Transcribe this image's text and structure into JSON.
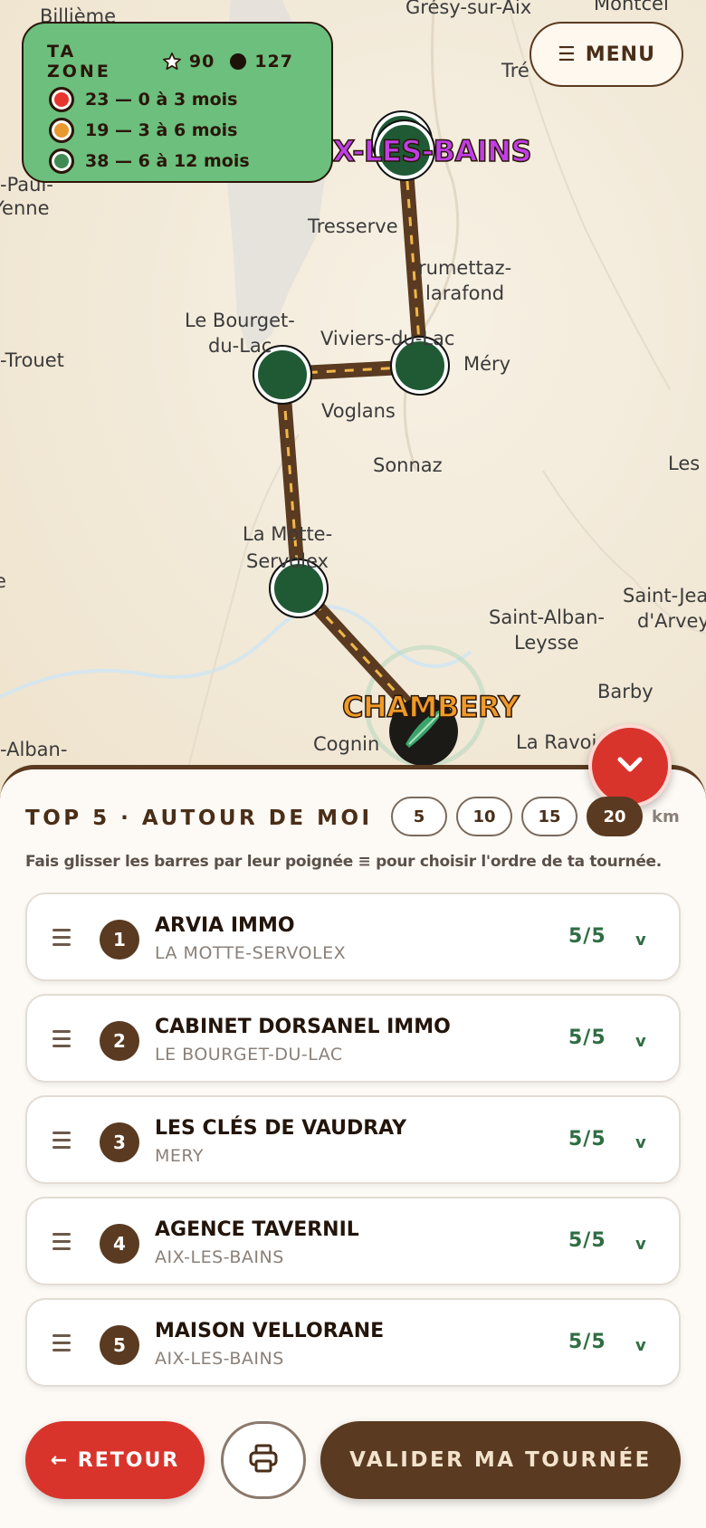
{
  "map": {
    "places": [
      {
        "id": "billieme",
        "label": "Billième"
      },
      {
        "id": "gresy",
        "label": "Grésy-sur-Aix"
      },
      {
        "id": "montcel",
        "label": "Montcel"
      },
      {
        "id": "tre",
        "label": "Tré"
      },
      {
        "id": "paul",
        "label": "-Paul-"
      },
      {
        "id": "enne",
        "label": "Yenne"
      },
      {
        "id": "tresserve",
        "label": "Tresserve"
      },
      {
        "id": "drumettaz1",
        "label": "rumettaz-"
      },
      {
        "id": "drumettaz2",
        "label": "larafond"
      },
      {
        "id": "bourget1",
        "label": "Le Bourget-"
      },
      {
        "id": "bourget2",
        "label": "du-Lac"
      },
      {
        "id": "viviers",
        "label": "Viviers-du-Lac"
      },
      {
        "id": "mery",
        "label": "Méry"
      },
      {
        "id": "trouet",
        "label": "-Trouet"
      },
      {
        "id": "voglans",
        "label": "Voglans"
      },
      {
        "id": "sonnaz",
        "label": "Sonnaz"
      },
      {
        "id": "les",
        "label": "Les"
      },
      {
        "id": "motte1",
        "label": "La Motte-"
      },
      {
        "id": "motte2",
        "label": "Servolex"
      },
      {
        "id": "saintjean1",
        "label": "Saint-Jean"
      },
      {
        "id": "saintjean2",
        "label": "d'Arvey"
      },
      {
        "id": "stalban1",
        "label": "Saint-Alban-"
      },
      {
        "id": "stalban2",
        "label": "Leysse"
      },
      {
        "id": "barby",
        "label": "Barby"
      },
      {
        "id": "cognin",
        "label": "Cognin"
      },
      {
        "id": "ravoire",
        "label": "La Ravoire"
      },
      {
        "id": "alban",
        "label": "-Alban-"
      },
      {
        "id": "e",
        "label": "e"
      }
    ],
    "city_aix": "AIX-LES-BAINS",
    "city_chambery": "CHAMBERY"
  },
  "zone": {
    "title": "TA ZONE",
    "stars": "90",
    "dots": "127",
    "legend": [
      {
        "color": "#e8342c",
        "label": "23 — 0 à 3 mois"
      },
      {
        "color": "#e89a30",
        "label": "19 — 3 à 6 mois"
      },
      {
        "color": "#3f8a55",
        "label": "38 — 6 à 12 mois"
      }
    ]
  },
  "menu": {
    "label": "MENU"
  },
  "sheet": {
    "title": "TOP 5 · AUTOUR DE MOI",
    "km_options": [
      "5",
      "10",
      "15",
      "20"
    ],
    "km_selected": "20",
    "km_unit": "km",
    "hint": "Fais glisser les barres par leur poignée ≡ pour choisir l'ordre de ta tournée.",
    "items": [
      {
        "rank": "1",
        "name": "ARVIA IMMO",
        "town": "LA MOTTE-SERVOLEX",
        "score": "5/5",
        "chevron": "v"
      },
      {
        "rank": "2",
        "name": "CABINET DORSANEL IMMO",
        "town": "LE BOURGET-DU-LAC",
        "score": "5/5",
        "chevron": "v"
      },
      {
        "rank": "3",
        "name": "LES CLÉS DE VAUDRAY",
        "town": "MERY",
        "score": "5/5",
        "chevron": "v"
      },
      {
        "rank": "4",
        "name": "AGENCE TAVERNIL",
        "town": "AIX-LES-BAINS",
        "score": "5/5",
        "chevron": "v"
      },
      {
        "rank": "5",
        "name": "MAISON VELLORANE",
        "town": "AIX-LES-BAINS",
        "score": "5/5",
        "chevron": "v"
      }
    ]
  },
  "actions": {
    "back": "← RETOUR",
    "validate": "VALIDER MA TOURNÉE"
  },
  "colors": {
    "brown": "#5a3a20",
    "red": "#d9342c",
    "green_zone": "#6cbf7d",
    "score_green": "#2f6e43"
  }
}
